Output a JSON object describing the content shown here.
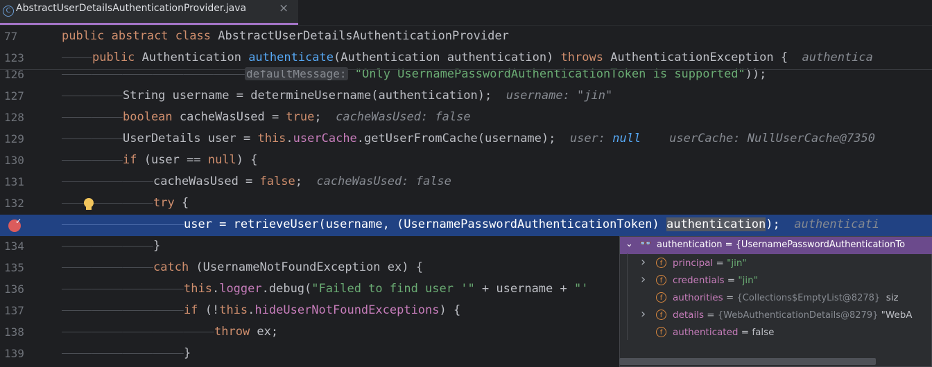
{
  "tab": {
    "icon_letter": "C",
    "filename": "AbstractUserDetailsAuthenticationProvider.java",
    "close": "×"
  },
  "lines": [
    {
      "num": "77",
      "tokens": [
        {
          "t": "public ",
          "c": "kw"
        },
        {
          "t": "abstract ",
          "c": "kw"
        },
        {
          "t": "class ",
          "c": "kw"
        },
        {
          "t": "AbstractUserDetailsAuthenticationProvider",
          "c": "typ"
        }
      ]
    },
    {
      "num": "123",
      "indent": 1,
      "tokens": [
        {
          "t": "public ",
          "c": "kw"
        },
        {
          "t": "Authentication ",
          "c": "typ"
        },
        {
          "t": "authenticate",
          "c": "fn"
        },
        {
          "t": "(Authentication authentication) ",
          "c": "typ"
        },
        {
          "t": "throws ",
          "c": "kw"
        },
        {
          "t": "AuthenticationException {  ",
          "c": "typ"
        },
        {
          "t": "authentica",
          "c": "hint"
        }
      ]
    },
    {
      "num": "126",
      "indent": 6,
      "tokens": [
        {
          "t": "defaultMessage:",
          "c": "param-hint"
        },
        {
          "t": " ",
          "c": "typ"
        },
        {
          "t": "\"Only UsernamePasswordAuthenticationToken is supported\"",
          "c": "str"
        },
        {
          "t": "));",
          "c": "typ"
        }
      ]
    },
    {
      "num": "127",
      "indent": 2,
      "tokens": [
        {
          "t": "String username = determineUsername(authentication);  ",
          "c": "typ"
        },
        {
          "t": "username: \"jin\"",
          "c": "hint"
        }
      ]
    },
    {
      "num": "128",
      "indent": 2,
      "tokens": [
        {
          "t": "boolean ",
          "c": "kw"
        },
        {
          "t": "cacheWasUsed = ",
          "c": "typ"
        },
        {
          "t": "true",
          "c": "kw"
        },
        {
          "t": ";  ",
          "c": "typ"
        },
        {
          "t": "cacheWasUsed: false",
          "c": "hint"
        }
      ]
    },
    {
      "num": "129",
      "indent": 2,
      "tokens": [
        {
          "t": "UserDetails user = ",
          "c": "typ"
        },
        {
          "t": "this",
          "c": "kw"
        },
        {
          "t": ".",
          "c": "typ"
        },
        {
          "t": "userCache",
          "c": "fld"
        },
        {
          "t": ".getUserFromCache(username);  ",
          "c": "typ"
        },
        {
          "t": "user: ",
          "c": "hint"
        },
        {
          "t": "null",
          "c": "hintnull"
        },
        {
          "t": "    userCache: NullUserCache@7350",
          "c": "hint"
        }
      ]
    },
    {
      "num": "130",
      "indent": 2,
      "tokens": [
        {
          "t": "if ",
          "c": "kw"
        },
        {
          "t": "(user == ",
          "c": "typ"
        },
        {
          "t": "null",
          "c": "kw"
        },
        {
          "t": ") {",
          "c": "typ"
        }
      ]
    },
    {
      "num": "131",
      "indent": 3,
      "tokens": [
        {
          "t": "cacheWasUsed = ",
          "c": "typ"
        },
        {
          "t": "false",
          "c": "kw"
        },
        {
          "t": ";  ",
          "c": "typ"
        },
        {
          "t": "cacheWasUsed: false",
          "c": "hint"
        }
      ]
    },
    {
      "num": "132",
      "indent": 3,
      "tokens": [
        {
          "t": "try ",
          "c": "kw"
        },
        {
          "t": "{",
          "c": "typ"
        }
      ]
    },
    {
      "num": "",
      "indent": 4,
      "highlight": true,
      "tokens": [
        {
          "t": "user = retrieveUser(username, (UsernamePasswordAuthenticationToken) ",
          "c": "plain"
        },
        {
          "t": "authentication",
          "c": "sel"
        },
        {
          "t": ");  ",
          "c": "plain"
        },
        {
          "t": "authenticati",
          "c": "hint"
        }
      ]
    },
    {
      "num": "134",
      "indent": 3,
      "tokens": [
        {
          "t": "}",
          "c": "typ"
        }
      ]
    },
    {
      "num": "135",
      "indent": 3,
      "tokens": [
        {
          "t": "catch ",
          "c": "kw"
        },
        {
          "t": "(UsernameNotFoundException ex) {",
          "c": "typ"
        }
      ]
    },
    {
      "num": "136",
      "indent": 4,
      "tokens": [
        {
          "t": "this",
          "c": "kw"
        },
        {
          "t": ".",
          "c": "typ"
        },
        {
          "t": "logger",
          "c": "fld"
        },
        {
          "t": ".debug(",
          "c": "typ"
        },
        {
          "t": "\"Failed to find user '\"",
          "c": "str"
        },
        {
          "t": " + username + ",
          "c": "typ"
        },
        {
          "t": "\"'",
          "c": "str"
        }
      ]
    },
    {
      "num": "137",
      "indent": 4,
      "tokens": [
        {
          "t": "if ",
          "c": "kw"
        },
        {
          "t": "(!",
          "c": "typ"
        },
        {
          "t": "this",
          "c": "kw"
        },
        {
          "t": ".",
          "c": "typ"
        },
        {
          "t": "hideUserNotFoundExceptions",
          "c": "fld"
        },
        {
          "t": ") {",
          "c": "typ"
        }
      ]
    },
    {
      "num": "138",
      "indent": 5,
      "tokens": [
        {
          "t": "throw ",
          "c": "kw"
        },
        {
          "t": "ex;",
          "c": "typ"
        }
      ]
    },
    {
      "num": "139",
      "indent": 4,
      "tokens": [
        {
          "t": "}",
          "c": "typ"
        }
      ]
    }
  ],
  "debug_popup": {
    "header": "authentication = {UsernamePasswordAuthenticationTo",
    "rows": [
      {
        "expandable": true,
        "name": "principal",
        "eq": " = ",
        "value": "\"jin\"",
        "kind": "str"
      },
      {
        "expandable": true,
        "name": "credentials",
        "eq": " = ",
        "value": "\"jin\"",
        "kind": "str"
      },
      {
        "expandable": false,
        "name": "authorities",
        "eq": " = ",
        "value": "{Collections$EmptyList@8278}",
        "kind": "obj",
        "extra": "  siz"
      },
      {
        "expandable": true,
        "name": "details",
        "eq": " = ",
        "value": "{WebAuthenticationDetails@8279}",
        "kind": "obj",
        "extra": " \"WebA"
      },
      {
        "expandable": false,
        "name": "authenticated",
        "eq": " = ",
        "value": "false",
        "kind": "plain"
      }
    ]
  },
  "colors": {
    "background": "#1e1f22",
    "keyword": "#cf8e6d",
    "method": "#56a8f5",
    "string": "#6aab73",
    "field": "#c77dbb",
    "highlight_line": "#214283",
    "popup_header": "#6b4a8c"
  }
}
